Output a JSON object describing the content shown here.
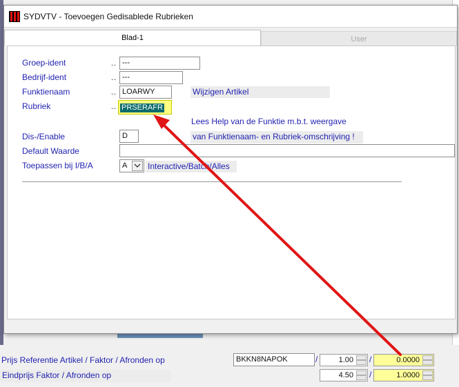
{
  "window": {
    "title": "SYDVTV - Toevoegen Gedisablede Rubrieken"
  },
  "tabs": [
    {
      "label": "Blad-1"
    },
    {
      "label": "User"
    }
  ],
  "form": {
    "dots": "..",
    "groep_label": "Groep-ident",
    "groep_value": "---",
    "bedrijf_label": "Bedrijf-ident",
    "bedrijf_value": "---",
    "funktie_label": "Funktienaam",
    "funktie_value": "LOARWY",
    "funktie_desc": "Wijzigen Artikel",
    "rubriek_label": "Rubriek",
    "rubriek_value": "PRSERAFR",
    "help_line1": "Lees Help van de Funktie m.b.t. weergave",
    "help_line2": "van Funktienaam- en Rubriek-omschrijving !",
    "disable_label": "Dis-/Enable",
    "disable_value": "D",
    "default_label": "Default Waarde",
    "default_value": "",
    "toepassen_label": "Toepassen bij I/B/A",
    "toepassen_value": "A",
    "toepassen_desc": "Interactive/Batch/Alles"
  },
  "bottom": {
    "prijs_label": "Prijs Referentie Artikel / Faktor / Afronden op",
    "prijs_code": "BKKN8NAPOK",
    "slash": "/",
    "prijs_faktor": "1.00",
    "prijs_afronden": "0.0000",
    "eind_label": "Eindprijs Faktor / Afronden op",
    "eind_faktor": "4.50",
    "eind_afronden": "1.0000"
  },
  "colors": {
    "label_blue": "#1f1fb0",
    "highlight_yellow": "#ffff80",
    "arrow_red": "#e01515"
  }
}
